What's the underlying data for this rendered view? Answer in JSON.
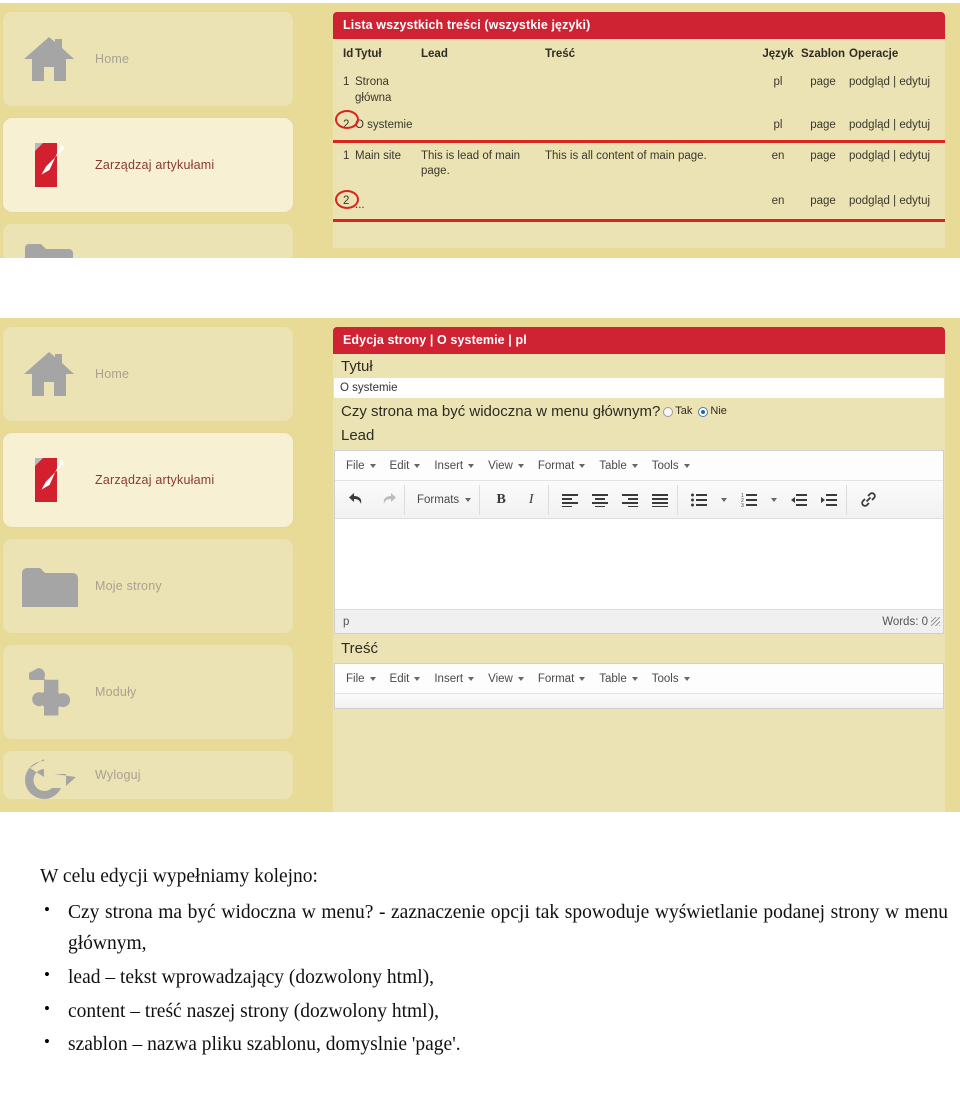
{
  "screenshot_one": {
    "sidebar": {
      "items": [
        {
          "label": "Home",
          "icon": "house-icon",
          "active": false
        },
        {
          "label": "Zarządzaj artykułami",
          "icon": "document-pencil-icon",
          "active": true
        },
        {
          "label": "",
          "icon": "folder-icon",
          "active": false
        }
      ]
    },
    "panel": {
      "header": "Lista wszystkich treści (wszystkie języki)",
      "table": {
        "columns": [
          "Id",
          "Tytuł",
          "Lead",
          "Treść",
          "Język",
          "Szablon",
          "Operacje"
        ],
        "rows": [
          {
            "id": "1",
            "tytul": "Strona główna",
            "lead": "",
            "tresc": "",
            "jezyk": "pl",
            "szablon": "page",
            "op_preview": "podgląd",
            "op_sep": "|",
            "op_edit": "edytuj",
            "marked": false,
            "underlined": false
          },
          {
            "id": "2",
            "tytul": "O systemie",
            "lead": "",
            "tresc": "",
            "jezyk": "pl",
            "szablon": "page",
            "op_preview": "podgląd",
            "op_sep": "|",
            "op_edit": "edytuj",
            "marked": true,
            "underlined": true
          },
          {
            "id": "1",
            "tytul": "Main site",
            "lead": "This is lead of main page.",
            "tresc": "This is all content of main page.",
            "jezyk": "en",
            "szablon": "page",
            "op_preview": "podgląd",
            "op_sep": "|",
            "op_edit": "edytuj",
            "marked": false,
            "underlined": false
          },
          {
            "id": "2",
            "tytul": "...",
            "lead": "",
            "tresc": "",
            "jezyk": "en",
            "szablon": "page",
            "op_preview": "podgląd",
            "op_sep": "|",
            "op_edit": "edytuj",
            "marked": true,
            "underlined": true
          }
        ]
      }
    }
  },
  "screenshot_two": {
    "sidebar": {
      "items": [
        {
          "label": "Home",
          "icon": "house-icon",
          "active": false
        },
        {
          "label": "Zarządzaj artykułami",
          "icon": "document-pencil-icon",
          "active": true
        },
        {
          "label": "Moje strony",
          "icon": "folder-icon",
          "active": false
        },
        {
          "label": "Moduły",
          "icon": "puzzle-piece-icon",
          "active": false
        },
        {
          "label": "Wyloguj",
          "icon": "logout-arrow-icon",
          "active": false
        }
      ]
    },
    "panel": {
      "header": "Edycja strony | O systemie | pl",
      "form": {
        "title_label": "Tytuł",
        "title_value": "O systemie",
        "title_placeholder": "",
        "visibility_question": "Czy strona ma być widoczna w menu głównym?",
        "radio_yes": "Tak",
        "radio_no": "Nie",
        "radio_selected": "Nie",
        "lead_label": "Lead",
        "content_label": "Treść"
      },
      "editor": {
        "menubar": [
          "File",
          "Edit",
          "Insert",
          "View",
          "Format",
          "Table",
          "Tools"
        ],
        "formats_label": "Formats",
        "bold_label": "B",
        "italic_label": "I",
        "toolbar_icons": [
          "undo-icon",
          "redo-icon",
          "formats-dropdown",
          "bold-icon",
          "italic-icon",
          "align-left-icon",
          "align-center-icon",
          "align-right-icon",
          "align-justify-icon",
          "bullet-list-icon",
          "numbered-list-icon",
          "outdent-icon",
          "indent-icon",
          "link-icon"
        ],
        "status_element": "p",
        "status_words": "Words: 0"
      }
    }
  },
  "document": {
    "intro": "W celu edycji wypełniamy kolejno:",
    "bullets": [
      "Czy strona ma być widoczna w menu? - zaznaczenie opcji tak spowoduje wyświetlanie podanej strony w menu głównym,",
      "lead – tekst wprowadzający (dozwolony html),",
      "content – treść naszej strony (dozwolony html),",
      "szablon – nazwa pliku szablonu, domyslnie 'page'."
    ]
  },
  "colors": {
    "panel_cream": "#ece3b4",
    "page_bg": "#e8db98",
    "header_red": "#cf2233",
    "annotation_red": "#d8261f",
    "icon_gray": "#a5a5a5",
    "accent_red_icon": "#d3202f",
    "active_label": "#8a3b33"
  }
}
